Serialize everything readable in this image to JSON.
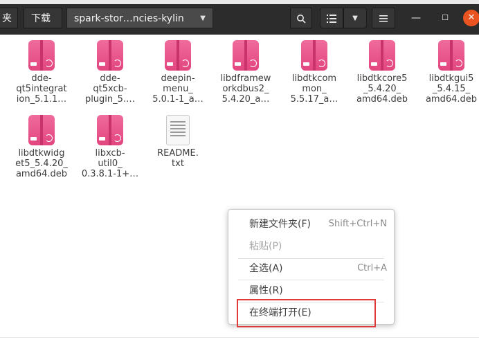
{
  "header": {
    "prev_crumb": "夹",
    "download_crumb": "下载",
    "current_crumb": "spark-stor…ncies-kylin",
    "current_dropdown_icon": "chevron-down-icon",
    "search_icon": "search-icon",
    "list_view_icon": "list-view-icon",
    "view_options_icon": "chevron-down-icon",
    "menu_icon": "hamburger-menu-icon",
    "minimize_icon": "minimize-icon",
    "maximize_icon": "maximize-icon",
    "close_icon": "close-icon",
    "close_color": "#e95420"
  },
  "files": [
    {
      "name": "dde-\nqt5integrat\nion_5.1.1…",
      "icon": "debian-package-icon"
    },
    {
      "name": "dde-\nqt5xcb-\nplugin_5.…",
      "icon": "debian-package-icon"
    },
    {
      "name": "deepin-\nmenu_\n5.0.1-1_a…",
      "icon": "debian-package-icon"
    },
    {
      "name": "libdframew\norkdbus2_\n5.4.20_a…",
      "icon": "debian-package-icon"
    },
    {
      "name": "libdtkcom\nmon_\n5.5.17_a…",
      "icon": "debian-package-icon"
    },
    {
      "name": "libdtkcore5\n_5.4.20_\namd64.deb",
      "icon": "debian-package-icon"
    },
    {
      "name": "libdtkgui5\n_5.4.15_\namd64.deb",
      "icon": "debian-package-icon"
    },
    {
      "name": "libdtkwidg\net5_5.4.20_\namd64.deb",
      "icon": "debian-package-icon"
    },
    {
      "name": "libxcb-\nutil0_\n0.3.8.1-1+…",
      "icon": "debian-package-icon"
    },
    {
      "name": "README.\ntxt",
      "icon": "text-file-icon"
    }
  ],
  "context_menu": {
    "items": [
      {
        "label": "新建文件夹(F)",
        "shortcut": "Shift+Ctrl+N",
        "enabled": true
      },
      {
        "label": "粘贴(P)",
        "shortcut": "",
        "enabled": false
      },
      {
        "label": "全选(A)",
        "shortcut": "Ctrl+A",
        "enabled": true
      },
      {
        "label": "属性(R)",
        "shortcut": "",
        "enabled": true
      },
      {
        "label": "在终端打开(E)",
        "shortcut": "",
        "enabled": true
      }
    ]
  },
  "highlight_color": "#e03a3a"
}
